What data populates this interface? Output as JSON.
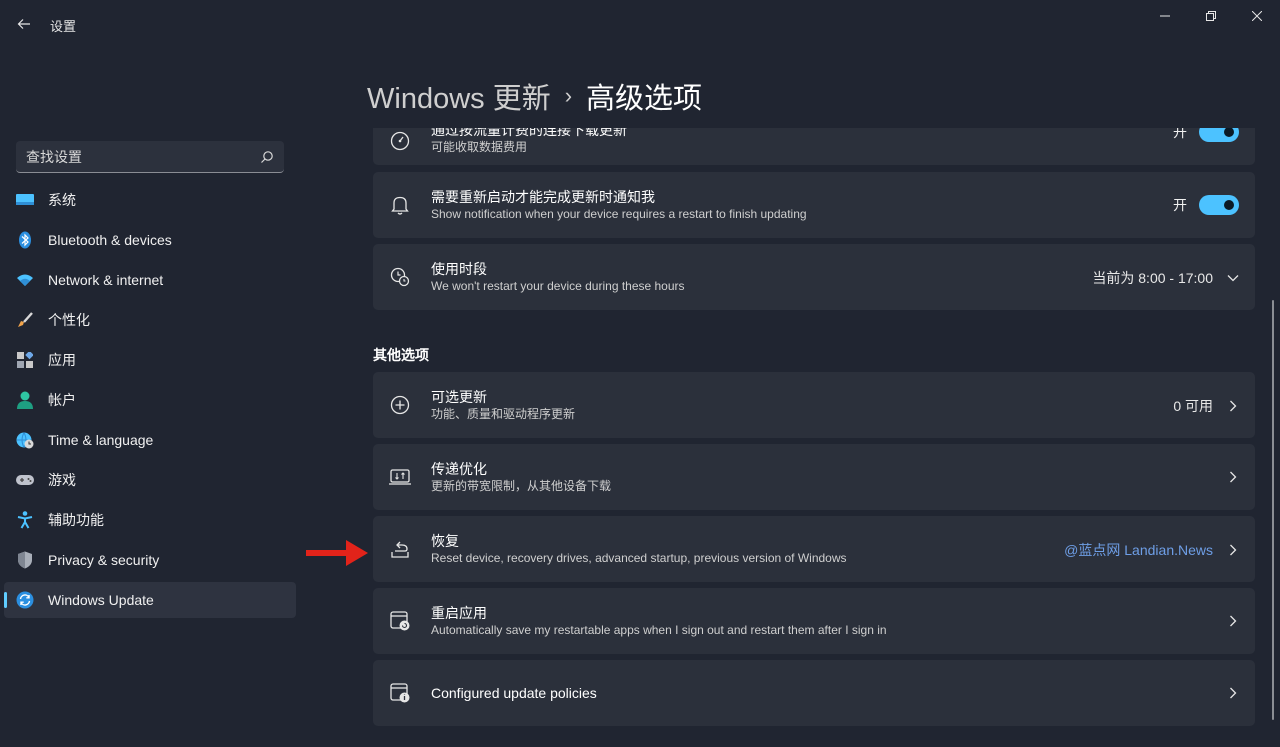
{
  "window": {
    "title": "设置",
    "back_icon": "back-arrow-icon",
    "controls": [
      "minimize-icon",
      "maximize-icon",
      "close-icon"
    ]
  },
  "search": {
    "placeholder": "查找设置",
    "icon": "search-icon"
  },
  "sidebar": {
    "items": [
      {
        "label": "系统",
        "icon": "system-monitor-icon",
        "active": false
      },
      {
        "label": "Bluetooth & devices",
        "icon": "bluetooth-icon",
        "active": false
      },
      {
        "label": "Network & internet",
        "icon": "wifi-icon",
        "active": false
      },
      {
        "label": "个性化",
        "icon": "brush-icon",
        "active": false
      },
      {
        "label": "应用",
        "icon": "apps-icon",
        "active": false
      },
      {
        "label": "帐户",
        "icon": "account-icon",
        "active": false
      },
      {
        "label": "Time & language",
        "icon": "globe-clock-icon",
        "active": false
      },
      {
        "label": "游戏",
        "icon": "gamepad-icon",
        "active": false
      },
      {
        "label": "辅助功能",
        "icon": "accessibility-icon",
        "active": false
      },
      {
        "label": "Privacy & security",
        "icon": "shield-icon",
        "active": false
      },
      {
        "label": "Windows Update",
        "icon": "windows-update-icon",
        "active": true
      }
    ]
  },
  "breadcrumb": {
    "parent": "Windows 更新",
    "separator": "›",
    "current": "高级选项"
  },
  "settings_top": [
    {
      "title": "通过按流量计费的连接下载更新",
      "desc": "可能收取数据费用",
      "toggle_label": "开",
      "toggle_on": true,
      "icon": "metered-icon"
    },
    {
      "title": "需要重新启动才能完成更新时通知我",
      "desc": "Show notification when your device requires a restart to finish updating",
      "toggle_label": "开",
      "toggle_on": true,
      "icon": "bell-icon"
    },
    {
      "title": "使用时段",
      "desc": "We won't restart your device during these hours",
      "value": "当前为 8:00 - 17:00",
      "icon": "active-hours-icon"
    }
  ],
  "other_section": {
    "label": "其他选项",
    "items": [
      {
        "title": "可选更新",
        "desc": "功能、质量和驱动程序更新",
        "value": "0 可用",
        "icon": "plus-circle-icon"
      },
      {
        "title": "传递优化",
        "desc": "更新的带宽限制，从其他设备下载",
        "value": "",
        "icon": "delivery-optimization-icon"
      },
      {
        "title": "恢复",
        "desc": "Reset device, recovery drives, advanced startup, previous version of Windows",
        "value": "@蓝点网 Landian.News",
        "icon": "recovery-icon"
      },
      {
        "title": "重启应用",
        "desc": "Automatically save my restartable apps when I sign out and restart them after I sign in",
        "value": "",
        "icon": "restart-apps-icon"
      },
      {
        "title": "Configured update policies",
        "desc": "",
        "value": "",
        "icon": "policy-icon"
      }
    ]
  },
  "colors": {
    "background": "#202531",
    "card": "#2b303b",
    "accent": "#4cc2ff",
    "arrow": "#e2231a",
    "watermark": "#6e9ee6"
  }
}
